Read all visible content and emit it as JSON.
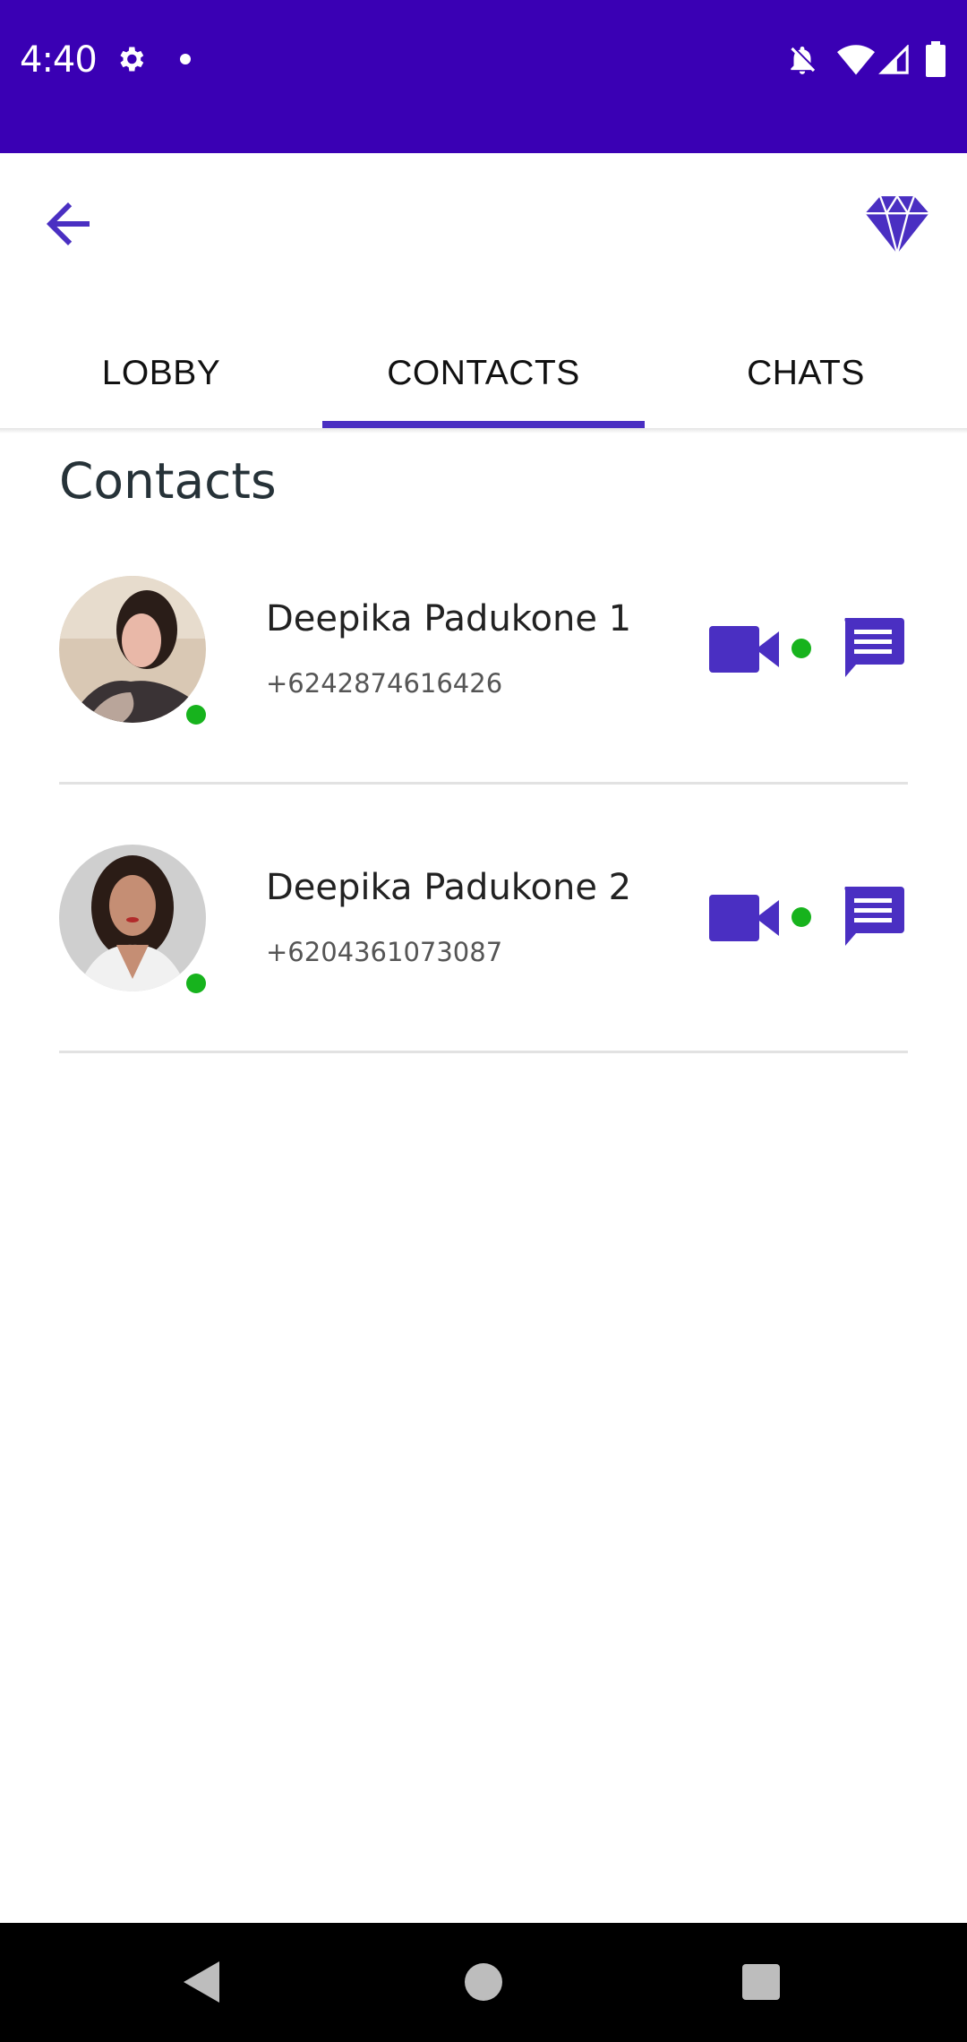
{
  "status_bar": {
    "time": "4:40",
    "icons": [
      "settings-icon",
      "notification-dot-icon",
      "bell-off-icon",
      "wifi-icon",
      "signal-icon",
      "battery-icon"
    ],
    "color": "#3a00b4"
  },
  "app_bar": {
    "back_icon": "arrow-back-icon",
    "premium_icon": "diamond-icon",
    "accent_color": "#4a2fc2"
  },
  "tabs": [
    {
      "label": "LOBBY",
      "selected": false
    },
    {
      "label": "CONTACTS",
      "selected": true
    },
    {
      "label": "CHATS",
      "selected": false
    }
  ],
  "section_title": "Contacts",
  "contacts": [
    {
      "name": "Deepika Padukone 1",
      "phone": "+6242874616426",
      "online": true
    },
    {
      "name": "Deepika Padukone 2",
      "phone": "+6204361073087",
      "online": true
    }
  ],
  "colors": {
    "online": "#17b31d",
    "action_icons": "#4a2fc2"
  },
  "nav_bar": {
    "icons": [
      "nav-back-icon",
      "nav-home-icon",
      "nav-recents-icon"
    ]
  }
}
